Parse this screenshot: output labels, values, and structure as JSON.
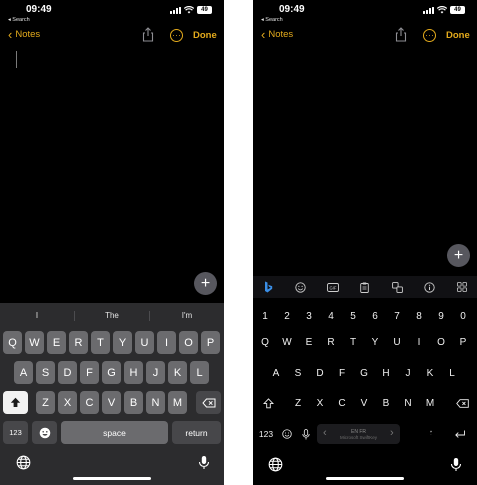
{
  "status": {
    "time": "09:49",
    "back_label": "◂ Search",
    "battery": "49"
  },
  "nav": {
    "back_label": "Notes",
    "done_label": "Done"
  },
  "fab": {
    "icon": "plus-icon"
  },
  "ios_keyboard": {
    "suggestions": [
      "I",
      "The",
      "I'm"
    ],
    "row1": [
      "Q",
      "W",
      "E",
      "R",
      "T",
      "Y",
      "U",
      "I",
      "O",
      "P"
    ],
    "row2": [
      "A",
      "S",
      "D",
      "F",
      "G",
      "H",
      "J",
      "K",
      "L"
    ],
    "row3": [
      "Z",
      "X",
      "C",
      "V",
      "B",
      "N",
      "M"
    ],
    "numbers_label": "123",
    "space_label": "space",
    "return_label": "return",
    "icons": [
      "shift-icon",
      "backspace-icon",
      "emoji-icon",
      "globe-icon",
      "microphone-icon"
    ]
  },
  "swiftkey_keyboard": {
    "toolbar_icons": [
      "bing-icon",
      "emoji-icon",
      "gif-icon",
      "clipboard-icon",
      "translate-icon",
      "info-icon",
      "grid-icon"
    ],
    "numbers": [
      "1",
      "2",
      "3",
      "4",
      "5",
      "6",
      "7",
      "8",
      "9",
      "0"
    ],
    "row1": [
      "Q",
      "W",
      "E",
      "R",
      "T",
      "Y",
      "U",
      "I",
      "O",
      "P"
    ],
    "row2": [
      "A",
      "S",
      "D",
      "F",
      "G",
      "H",
      "J",
      "K",
      "L"
    ],
    "row3": [
      "Z",
      "X",
      "C",
      "V",
      "B",
      "N",
      "M"
    ],
    "numbers_label": "123",
    "space_language": "EN FR",
    "space_sub": "Microsoft SwiftKey",
    "period_label": ".",
    "icons": [
      "shift-icon",
      "backspace-icon",
      "emoji-icon",
      "microphone-icon",
      "arrow-left-icon",
      "arrow-right-icon",
      "enter-icon",
      "globe-icon"
    ]
  },
  "colors": {
    "accent": "#e3aa1c",
    "keyboard_bg": "#2c2c2e",
    "key_bg": "#6b6b6e"
  }
}
